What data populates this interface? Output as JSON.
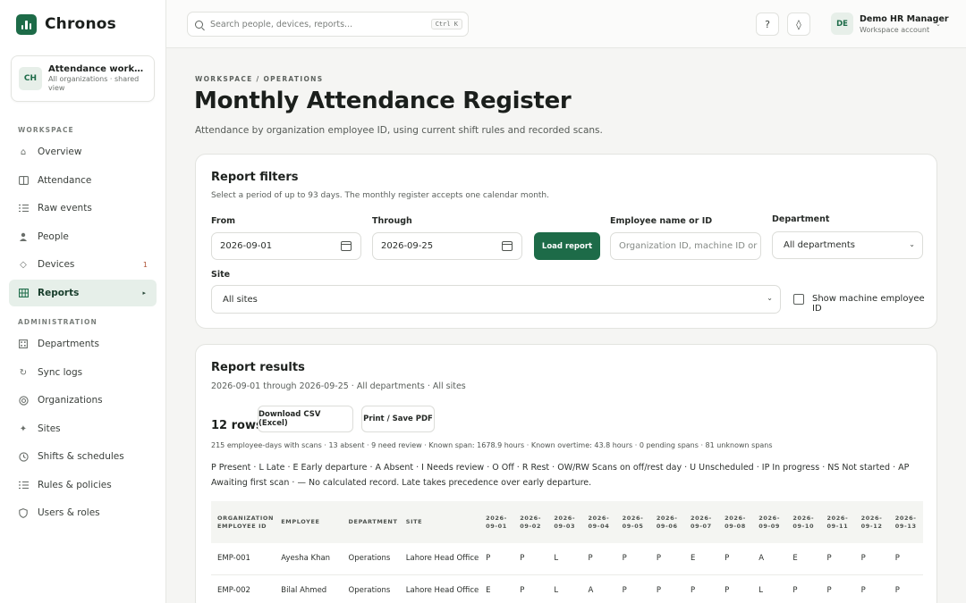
{
  "app": {
    "name": "Chronos"
  },
  "workspace_card": {
    "avatar": "CH",
    "title": "Attendance workspace",
    "subtitle": "All organizations · shared view"
  },
  "sidebar": {
    "section_workspace": "WORKSPACE",
    "section_admin": "ADMINISTRATION",
    "items": [
      {
        "label": "Overview",
        "icon": "home-icon"
      },
      {
        "label": "Attendance",
        "icon": "book-icon"
      },
      {
        "label": "Raw events",
        "icon": "list-icon"
      },
      {
        "label": "People",
        "icon": "person-icon"
      },
      {
        "label": "Devices",
        "icon": "diamond-icon",
        "badge": "1"
      },
      {
        "label": "Reports",
        "icon": "grid-icon",
        "active": true
      },
      {
        "label": "Departments",
        "icon": "building-icon"
      },
      {
        "label": "Sync logs",
        "icon": "refresh-icon"
      },
      {
        "label": "Organizations",
        "icon": "target-icon"
      },
      {
        "label": "Sites",
        "icon": "sparkle-icon"
      },
      {
        "label": "Shifts & schedules",
        "icon": "clock-icon"
      },
      {
        "label": "Rules & policies",
        "icon": "rules-icon"
      },
      {
        "label": "Users & roles",
        "icon": "user-shield-icon"
      }
    ]
  },
  "topbar": {
    "search_placeholder": "Search people, devices, reports...",
    "shortcut": "Ctrl K",
    "help_glyph": "?",
    "theme_glyph": "◊",
    "user_avatar": "DE",
    "user_name": "Demo HR Manager",
    "user_role": "Workspace account"
  },
  "page": {
    "breadcrumb": "WORKSPACE / OPERATIONS",
    "title": "Monthly Attendance Register",
    "subtitle": "Attendance by organization employee ID, using current shift rules and recorded scans."
  },
  "filters": {
    "title": "Report filters",
    "subtitle": "Select a period of up to 93 days. The monthly register accepts one calendar month.",
    "from_label": "From",
    "from_value": "2026-09-01",
    "through_label": "Through",
    "through_value": "2026-09-25",
    "load_button": "Load report",
    "employee_label": "Employee name or ID",
    "employee_placeholder": "Organization ID, machine ID or name",
    "department_label": "Department",
    "department_value": "All departments",
    "site_label": "Site",
    "site_value": "All sites",
    "machine_id_label": "Show machine employee ID",
    "machine_id_checked": false
  },
  "results": {
    "title": "Report results",
    "subtitle": "2026-09-01 through 2026-09-25 · All departments · All sites",
    "rows_count": "12 rows",
    "csv_button": "Download CSV (Excel)",
    "print_button": "Print / Save PDF",
    "stats": "215 employee-days with scans · 13 absent · 9 need review · Known span: 1678.9 hours · Known overtime: 43.8 hours · 0 pending spans · 81 unknown spans",
    "legend": "P Present · L Late · E Early departure · A Absent · I Needs review · O Off · R Rest · OW/RW Scans on off/rest day · U Unscheduled · IP In progress · NS Not started · AP Awaiting first scan · — No calculated record. Late takes precedence over early departure.",
    "table": {
      "columns": [
        "ORGANIZATION EMPLOYEE ID",
        "EMPLOYEE",
        "DEPARTMENT",
        "SITE",
        "2026-09-01",
        "2026-09-02",
        "2026-09-03",
        "2026-09-04",
        "2026-09-05",
        "2026-09-06",
        "2026-09-07",
        "2026-09-08",
        "2026-09-09",
        "2026-09-10",
        "2026-09-11",
        "2026-09-12",
        "2026-09-13"
      ],
      "rows": [
        [
          "EMP-001",
          "Ayesha Khan",
          "Operations",
          "Lahore Head Office",
          "P",
          "P",
          "L",
          "P",
          "P",
          "P",
          "E",
          "P",
          "A",
          "E",
          "P",
          "P",
          "P"
        ],
        [
          "EMP-002",
          "Bilal Ahmed",
          "Operations",
          "Lahore Head Office",
          "E",
          "P",
          "L",
          "A",
          "P",
          "P",
          "P",
          "P",
          "L",
          "P",
          "P",
          "P",
          "P"
        ]
      ]
    }
  }
}
